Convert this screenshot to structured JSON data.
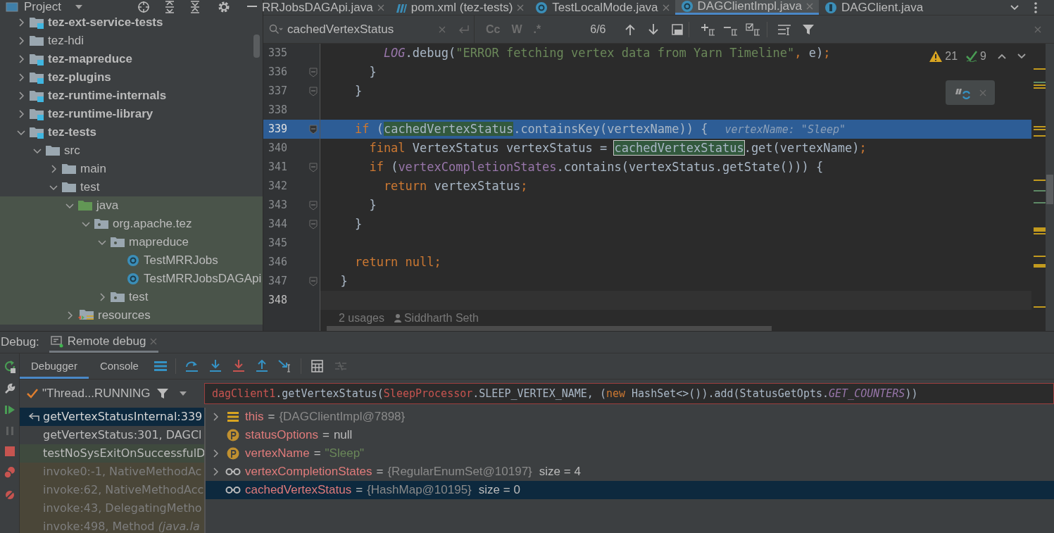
{
  "project_panel": {
    "title": "Project",
    "tree": [
      {
        "label": "tez-ext-service-tests",
        "kind": "module",
        "bold": true,
        "expanded": false,
        "test_scope": false
      },
      {
        "label": "tez-hdi",
        "kind": "folder",
        "bold": false,
        "expanded": false,
        "test_scope": false
      },
      {
        "label": "tez-mapreduce",
        "kind": "module",
        "bold": true,
        "expanded": false,
        "test_scope": false
      },
      {
        "label": "tez-plugins",
        "kind": "module",
        "bold": true,
        "expanded": false,
        "test_scope": false
      },
      {
        "label": "tez-runtime-internals",
        "kind": "module",
        "bold": true,
        "expanded": false,
        "test_scope": false
      },
      {
        "label": "tez-runtime-library",
        "kind": "module",
        "bold": true,
        "expanded": false,
        "test_scope": false
      },
      {
        "label": "tez-tests",
        "kind": "module",
        "bold": true,
        "expanded": true,
        "test_scope": false,
        "children": [
          {
            "label": "src",
            "kind": "folder",
            "bold": false,
            "expanded": true,
            "test_scope": false,
            "children": [
              {
                "label": "main",
                "kind": "folder",
                "bold": false,
                "expanded": false,
                "test_scope": false
              },
              {
                "label": "test",
                "kind": "folder",
                "bold": false,
                "expanded": true,
                "test_scope": false,
                "children": [
                  {
                    "label": "java",
                    "kind": "source",
                    "bold": false,
                    "expanded": true,
                    "test_scope": true,
                    "children": [
                      {
                        "label": "org.apache.tez",
                        "kind": "package",
                        "bold": false,
                        "expanded": true,
                        "test_scope": true,
                        "children": [
                          {
                            "label": "mapreduce",
                            "kind": "package",
                            "bold": false,
                            "expanded": true,
                            "test_scope": true,
                            "children": [
                              {
                                "label": "TestMRRJobs",
                                "kind": "class",
                                "bold": false,
                                "test_scope": true
                              },
                              {
                                "label": "TestMRRJobsDAGApi",
                                "kind": "class",
                                "bold": false,
                                "test_scope": true
                              }
                            ]
                          },
                          {
                            "label": "test",
                            "kind": "package",
                            "bold": false,
                            "expanded": false,
                            "test_scope": true
                          }
                        ]
                      }
                    ]
                  },
                  {
                    "label": "resources",
                    "kind": "resources",
                    "bold": false,
                    "expanded": false,
                    "test_scope": true
                  }
                ]
              }
            ]
          }
        ]
      }
    ]
  },
  "editor_tabs": [
    {
      "label": "RRJobsDAGApi.java",
      "kind": "class",
      "selected": false,
      "closable": true
    },
    {
      "label": "pom.xml (tez-tests)",
      "kind": "maven",
      "selected": false,
      "closable": true
    },
    {
      "label": "TestLocalMode.java",
      "kind": "class",
      "selected": false,
      "closable": true
    },
    {
      "label": "DAGClientImpl.java",
      "kind": "class",
      "selected": true,
      "closable": true
    },
    {
      "label": "DAGClient.java",
      "kind": "interface",
      "selected": false,
      "closable": false
    }
  ],
  "search": {
    "value": "cachedVertexStatus",
    "options": [
      "Cc",
      "W",
      ".*"
    ],
    "match_count": "6/6"
  },
  "inspections": {
    "warnings": "21",
    "weak_warnings": "9"
  },
  "code_lines": [
    {
      "number": "335",
      "fold": false,
      "selected": false,
      "caret": false,
      "tokens": [
        {
          "text": "        LOG",
          "kind": "sfld"
        },
        {
          "text": ".debug(",
          "kind": "p"
        },
        {
          "text": "\"ERROR fetching vertex data from Yarn Timeline\"",
          "kind": "str"
        },
        {
          "text": ", ",
          "kind": "kw"
        },
        {
          "text": "e)",
          "kind": "p"
        },
        {
          "text": ";",
          "kind": "kw"
        }
      ]
    },
    {
      "number": "336",
      "fold": true,
      "selected": false,
      "caret": false,
      "tokens": [
        {
          "text": "      }",
          "kind": "p"
        }
      ]
    },
    {
      "number": "337",
      "fold": true,
      "selected": false,
      "caret": false,
      "tokens": [
        {
          "text": "    }",
          "kind": "p"
        }
      ]
    },
    {
      "number": "338",
      "fold": false,
      "selected": false,
      "caret": false
    },
    {
      "number": "339",
      "fold": true,
      "selected": true,
      "caret": false,
      "tokens": [
        {
          "text": "    if",
          "kind": "kw"
        },
        {
          "text": " (",
          "kind": "p"
        },
        {
          "text": "cachedVertexStatus",
          "kind": "match"
        },
        {
          "text": ".containsKey(vertexName)) {",
          "kind": "p"
        },
        {
          "text": "vertexName: \"Sleep\"",
          "kind": "hint"
        }
      ]
    },
    {
      "number": "340",
      "fold": false,
      "selected": false,
      "caret": false,
      "tokens": [
        {
          "text": "      final",
          "kind": "kw"
        },
        {
          "text": " VertexStatus vertexStatus = ",
          "kind": "p"
        },
        {
          "text": "cachedVertexStatus",
          "kind": "current"
        },
        {
          "text": ".get(vertexName)",
          "kind": "p"
        },
        {
          "text": ";",
          "kind": "kw"
        }
      ]
    },
    {
      "number": "341",
      "fold": true,
      "selected": false,
      "caret": false,
      "tokens": [
        {
          "text": "      if",
          "kind": "kw"
        },
        {
          "text": " (",
          "kind": "p"
        },
        {
          "text": "vertexCompletionStates",
          "kind": "fld"
        },
        {
          "text": ".contains(vertexStatus.getState())) {",
          "kind": "p"
        }
      ]
    },
    {
      "number": "342",
      "fold": false,
      "selected": false,
      "caret": false,
      "tokens": [
        {
          "text": "        return",
          "kind": "kw"
        },
        {
          "text": " vertexStatus",
          "kind": "p"
        },
        {
          "text": ";",
          "kind": "kw"
        }
      ]
    },
    {
      "number": "343",
      "fold": true,
      "selected": false,
      "caret": false,
      "tokens": [
        {
          "text": "      }",
          "kind": "p"
        }
      ]
    },
    {
      "number": "344",
      "fold": true,
      "selected": false,
      "caret": false,
      "tokens": [
        {
          "text": "    }",
          "kind": "p"
        }
      ]
    },
    {
      "number": "345",
      "fold": false,
      "selected": false,
      "caret": false
    },
    {
      "number": "346",
      "fold": false,
      "selected": false,
      "caret": false,
      "tokens": [
        {
          "text": "    return null;",
          "kind": "kw"
        }
      ]
    },
    {
      "number": "347",
      "fold": true,
      "selected": false,
      "caret": false,
      "tokens": [
        {
          "text": "  }",
          "kind": "p"
        }
      ]
    },
    {
      "number": "348",
      "fold": false,
      "selected": false,
      "caret": true
    }
  ],
  "code_vision": {
    "usages": "2 usages",
    "author": "Siddharth Seth"
  },
  "debug": {
    "label": "Debug:",
    "session_tab": "Remote debug",
    "tabs": [
      {
        "label": "Debugger",
        "selected": true
      },
      {
        "label": "Console",
        "selected": false
      }
    ],
    "thread": "\"Thread...RUNNING",
    "expression": [
      {
        "text": "dagClient1",
        "kind": "err"
      },
      {
        "text": ".getVertexStatus(",
        "kind": "p"
      },
      {
        "text": "SleepProcessor",
        "kind": "err"
      },
      {
        "text": ".SLEEP_VERTEX_NAME, (",
        "kind": "p"
      },
      {
        "text": "new",
        "kind": "kw"
      },
      {
        "text": " HashSet<>()).add(StatusGetOpts.",
        "kind": "p"
      },
      {
        "text": "GET_COUNTERS",
        "kind": "sfld"
      },
      {
        "text": "))",
        "kind": "p"
      }
    ],
    "frames": [
      {
        "text": "getVertexStatusInternal:339",
        "kind": "project",
        "selected": true
      },
      {
        "text": "getVertexStatus:301, DAGCl",
        "kind": "project",
        "selected": false
      },
      {
        "text": "testNoSysExitOnSuccessfulD",
        "kind": "test",
        "selected": false
      },
      {
        "text": "invoke0:-1, NativeMethodAc",
        "kind": "library",
        "selected": false
      },
      {
        "text": "invoke:62, NativeMethodAcc",
        "kind": "library",
        "selected": false
      },
      {
        "text": "invoke:43, DelegatingMetho",
        "kind": "library",
        "selected": false
      },
      {
        "text": "invoke:498, Method *(java.la*",
        "kind": "library",
        "selected": false
      }
    ],
    "variables": [
      {
        "kind": "field",
        "expandable": true,
        "name": "this",
        "equals": "=",
        "value": {
          "text": "{DAGClientImpl@7898}",
          "kind": "ref"
        },
        "selected": false
      },
      {
        "kind": "param",
        "expandable": false,
        "name": "statusOptions",
        "equals": "=",
        "value": {
          "text": "null",
          "kind": "plain"
        },
        "selected": false
      },
      {
        "kind": "param",
        "expandable": true,
        "name": "vertexName",
        "equals": "=",
        "value": {
          "text": "\"Sleep\"",
          "kind": "string"
        },
        "selected": false
      },
      {
        "kind": "watch",
        "expandable": true,
        "name": "vertexCompletionStates",
        "equals": "=",
        "value": {
          "text": "{RegularEnumSet@10197}",
          "kind": "ref"
        },
        "extra": "size = 4",
        "selected": false
      },
      {
        "kind": "watch",
        "expandable": false,
        "name": "cachedVertexStatus",
        "equals": "=",
        "value": {
          "text": "{HashMap@10195}",
          "kind": "ref"
        },
        "extra": "size = 0",
        "selected": true
      }
    ]
  }
}
